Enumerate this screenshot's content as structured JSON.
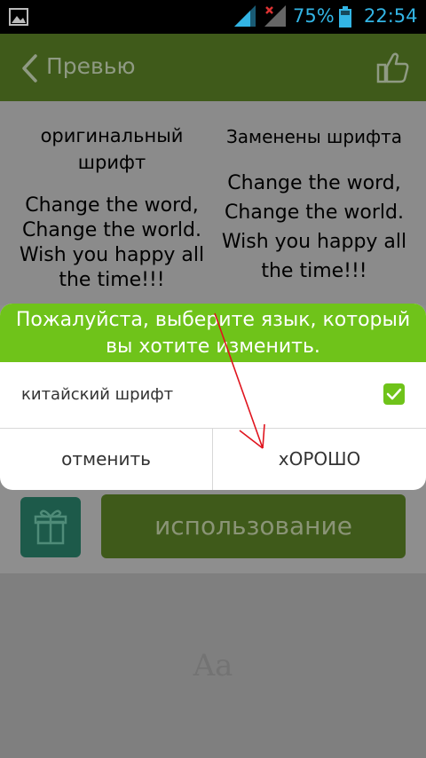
{
  "status_bar": {
    "battery_percent": "75%",
    "time": "22:54",
    "icons": [
      "image-notification-icon",
      "signal-icon",
      "signal-no-sim-icon",
      "battery-icon"
    ]
  },
  "toolbar": {
    "title": "Превью",
    "back_icon": "chevron-left-icon",
    "like_icon": "thumbs-up-icon"
  },
  "preview": {
    "original": {
      "header": "оригинальный шрифт",
      "lines": [
        "Change the word,",
        "Change the world.",
        "Wish you happy all",
        "the time!!!"
      ]
    },
    "replaced": {
      "header": "Заменены шрифта",
      "lines": [
        "Change the word,",
        "Change the world.",
        "Wish you happy all",
        "the time!!!"
      ]
    }
  },
  "dialog": {
    "title": "Пожалуйста, выберите язык, который вы хотите изменить.",
    "option": {
      "label": "китайский шрифт",
      "checked": true
    },
    "cancel_label": "отменить",
    "ok_label": "хОРОШО"
  },
  "actions": {
    "gift_icon": "gift-icon",
    "use_label": "использование"
  },
  "font_sample": {
    "text": "Aa"
  },
  "colors": {
    "accent_green": "#6fc31a",
    "status_blue": "#33b5e5",
    "annotation_red": "#e0141e"
  }
}
